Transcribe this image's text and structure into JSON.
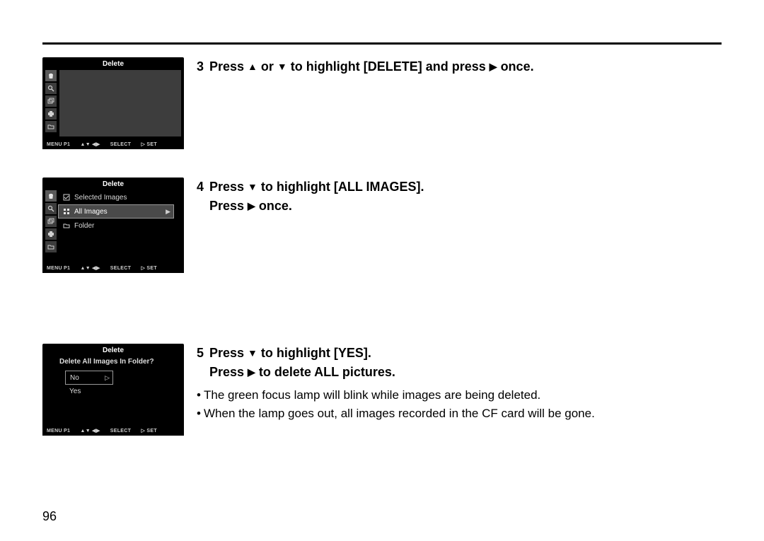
{
  "page_number": "96",
  "screens": {
    "a": {
      "title": "Delete",
      "footer": {
        "menu": "MENU P1",
        "nav": "▲▼ ◀▶",
        "select": "SELECT",
        "set": "▷  SET"
      }
    },
    "b": {
      "title": "Delete",
      "items": [
        {
          "label": "Selected Images",
          "highlight": false
        },
        {
          "label": "All Images",
          "highlight": true
        },
        {
          "label": "Folder",
          "highlight": false
        }
      ],
      "footer": {
        "menu": "MENU P1",
        "nav": "▲▼ ◀▶",
        "select": "SELECT",
        "set": "▷  SET"
      }
    },
    "c": {
      "title": "Delete",
      "prompt": "Delete All Images In Folder?",
      "options": [
        {
          "label": "No",
          "boxed": true
        },
        {
          "label": "Yes",
          "boxed": false
        }
      ],
      "footer": {
        "menu": "MENU P1",
        "nav": "▲▼ ◀▶",
        "select": "SELECT",
        "set": "▷  SET"
      }
    }
  },
  "sidebar_icons": [
    "trash-icon",
    "magnify-icon",
    "multi-image-icon",
    "print-icon",
    "folder-icon"
  ],
  "steps": {
    "s3": {
      "num": "3",
      "pre": "Press ",
      "mid": " or ",
      "tail": "  to highlight [DELETE] and press ",
      "end": " once."
    },
    "s4": {
      "num": "4",
      "line1_pre": "Press ",
      "line1_tail": "   to highlight [ALL IMAGES].",
      "line2_pre": "Press ",
      "line2_tail": " once."
    },
    "s5": {
      "num": "5",
      "line1_pre": "Press ",
      "line1_tail": "  to highlight [YES].",
      "line2_pre": "Press ",
      "line2_tail": " to delete ALL pictures."
    }
  },
  "notes": {
    "n1": "The green focus lamp will blink while images are being deleted.",
    "n2": "When the lamp goes out, all images recorded in the CF card will be gone."
  },
  "glyphs": {
    "up": "▲",
    "down": "▼",
    "right": "▶",
    "bullet": "•"
  }
}
